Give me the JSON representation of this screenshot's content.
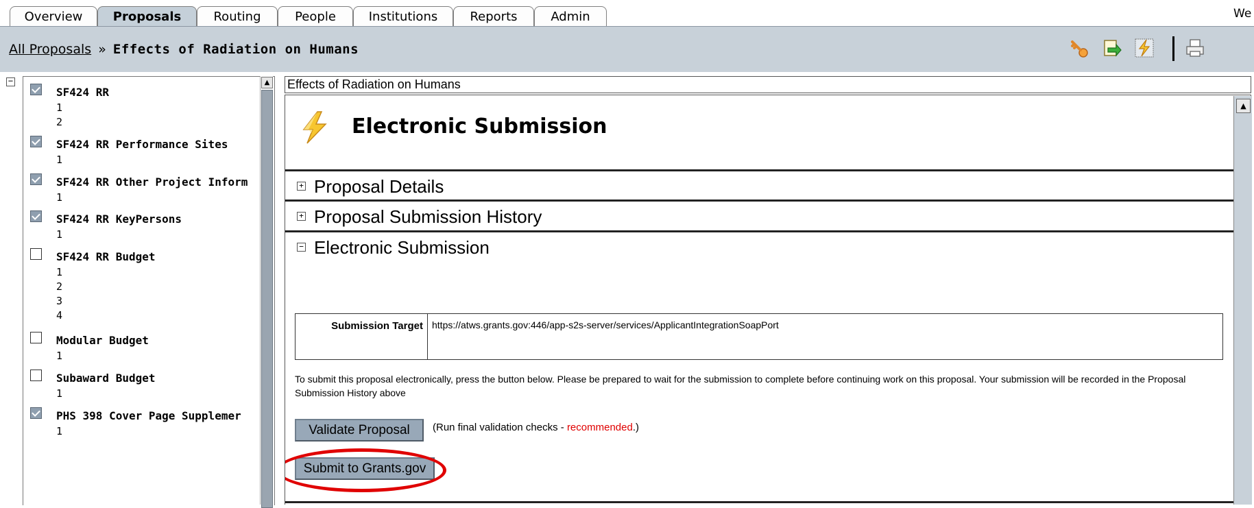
{
  "tabs": [
    {
      "label": "Overview",
      "active": false
    },
    {
      "label": "Proposals",
      "active": true
    },
    {
      "label": "Routing",
      "active": false
    },
    {
      "label": "People",
      "active": false
    },
    {
      "label": "Institutions",
      "active": false
    },
    {
      "label": "Reports",
      "active": false
    },
    {
      "label": "Admin",
      "active": false
    }
  ],
  "welcome_text": "We",
  "breadcrumb": {
    "root": "All Proposals",
    "separator": "»",
    "current": "Effects of Radiation on Humans"
  },
  "toolbar": {
    "icons": [
      "key-icon",
      "export-icon",
      "lightning-icon",
      "print-icon"
    ]
  },
  "nav": {
    "forms": [
      {
        "title": "SF424 RR",
        "checked": true,
        "pages": [
          "1",
          "2"
        ]
      },
      {
        "title": "SF424 RR Performance Sites",
        "checked": true,
        "pages": [
          "1"
        ]
      },
      {
        "title": "SF424 RR Other Project Inform",
        "checked": true,
        "pages": [
          "1"
        ]
      },
      {
        "title": "SF424 RR KeyPersons",
        "checked": true,
        "pages": [
          "1"
        ]
      },
      {
        "title": "SF424 RR Budget",
        "checked": false,
        "pages": [
          "1",
          "2",
          "3",
          "4"
        ]
      },
      {
        "title": "Modular Budget",
        "checked": false,
        "pages": [
          "1"
        ]
      },
      {
        "title": "Subaward Budget",
        "checked": false,
        "pages": [
          "1"
        ]
      },
      {
        "title": "PHS 398 Cover Page Supplemer",
        "checked": true,
        "pages": [
          "1"
        ]
      }
    ]
  },
  "main": {
    "doc_title": "Effects of Radiation on Humans",
    "page_heading": "Electronic Submission",
    "panels": [
      {
        "label": "Proposal Details",
        "expanded": false,
        "toggle": "+"
      },
      {
        "label": "Proposal Submission History",
        "expanded": false,
        "toggle": "+"
      },
      {
        "label": "Electronic Submission",
        "expanded": true,
        "toggle": "−"
      }
    ],
    "submission_target_label": "Submission Target",
    "submission_target_value": "https://atws.grants.gov:446/app-s2s-server/services/ApplicantIntegrationSoapPort",
    "instructions": "To submit this proposal electronically, press the button below. Please be prepared to wait for the submission to complete before continuing work on this proposal. Your submission will be recorded in the Proposal Submission History above",
    "validate_button": "Validate Proposal",
    "validate_note_prefix": "(Run final validation checks - ",
    "validate_note_emphasis": "recommended",
    "validate_note_suffix": ".)",
    "submit_button": "Submit to Grants.gov"
  },
  "colors": {
    "header_bg": "#c8d1d9",
    "button_bg": "#98a8b8",
    "highlight": "#e00000"
  }
}
